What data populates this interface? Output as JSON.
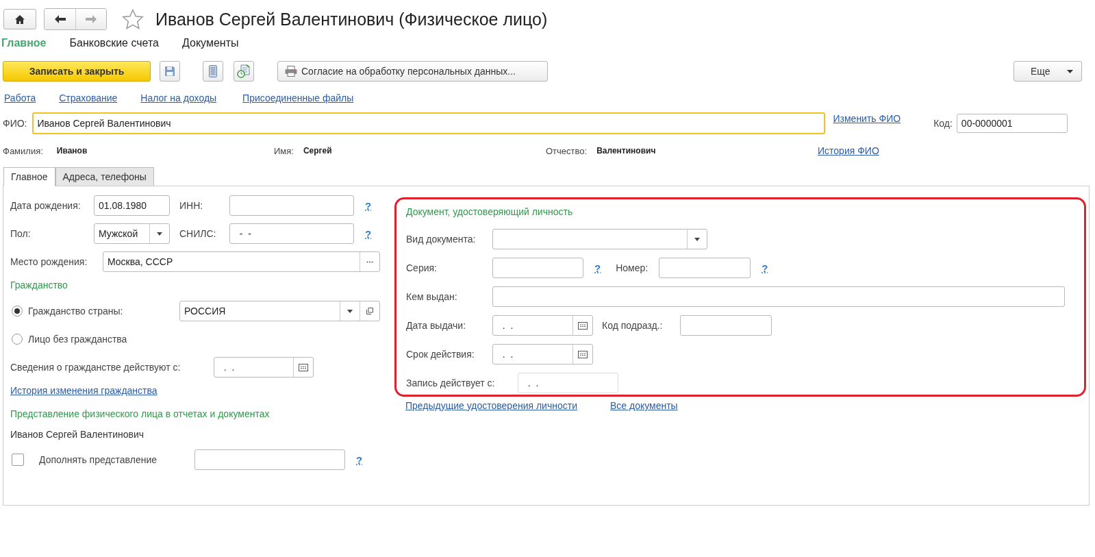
{
  "window": {
    "title": "Иванов Сергей Валентинович (Физическое лицо)"
  },
  "sections": [
    {
      "label": "Главное",
      "selected": true
    },
    {
      "label": "Банковские счета",
      "selected": false
    },
    {
      "label": "Документы",
      "selected": false
    }
  ],
  "toolbar": {
    "save_close": "Записать и закрыть",
    "consent": "Согласие на обработку персональных данных...",
    "more": "Еще"
  },
  "links": [
    "Работа",
    "Страхование",
    "Налог на доходы",
    "Присоединенные файлы"
  ],
  "fio": {
    "label": "ФИО:",
    "value": "Иванов Сергей Валентинович",
    "focused": true,
    "change_link": "Изменить ФИО",
    "history_link": "История ФИО"
  },
  "code": {
    "label": "Код:",
    "value": "00-0000001"
  },
  "name_parts": [
    {
      "label": "Фамилия:",
      "value": "Иванов"
    },
    {
      "label": "Имя:",
      "value": "Сергей"
    },
    {
      "label": "Отчество:",
      "value": "Валентинович"
    }
  ],
  "tabs": [
    {
      "label": "Главное",
      "selected": true
    },
    {
      "label": "Адреса, телефоны",
      "selected": false
    }
  ],
  "main_tab": {
    "birth_date": {
      "label": "Дата рождения:",
      "value": "01.08.1980"
    },
    "inn": {
      "label": "ИНН:",
      "help": "?"
    },
    "gender": {
      "label": "Пол:",
      "value": "Мужской"
    },
    "snils": {
      "label": "СНИЛС:",
      "value": "  -  -",
      "help": "?"
    },
    "birth_place": {
      "label": "Место рождения:",
      "value": "Москва, СССР"
    },
    "citizenship": {
      "heading": "Гражданство",
      "options": [
        {
          "label": "Гражданство страны:",
          "selected": true
        },
        {
          "label": "Лицо без гражданства",
          "selected": false
        }
      ],
      "country": {
        "value": "РОССИЯ"
      },
      "valid_from": {
        "label": "Сведения о гражданстве действуют с:",
        "value": "  .  ."
      },
      "history_link": "История изменения гражданства"
    },
    "representation": {
      "heading": "Представление физического лица в отчетах и документах",
      "value": "Иванов Сергей Валентинович",
      "extend": {
        "label": "Дополнять представление",
        "checked": false,
        "help": "?"
      }
    }
  },
  "identity_document": {
    "heading": "Документ, удостоверяющий личность",
    "doc_type": {
      "label": "Вид документа:"
    },
    "series": {
      "label": "Серия:",
      "help": "?"
    },
    "number": {
      "label": "Номер:",
      "help": "?"
    },
    "issued_by": {
      "label": "Кем выдан:"
    },
    "issue_date": {
      "label": "Дата выдачи:",
      "value": "  .  ."
    },
    "dept_code": {
      "label": "Код подразд.:"
    },
    "expiry": {
      "label": "Срок действия:",
      "value": "  .  ."
    },
    "record_from": {
      "label": "Запись действует с:",
      "value": "  .  .",
      "disabled": true
    }
  },
  "document_links": [
    "Предыдущие удостоверения личности",
    "Все документы"
  ]
}
